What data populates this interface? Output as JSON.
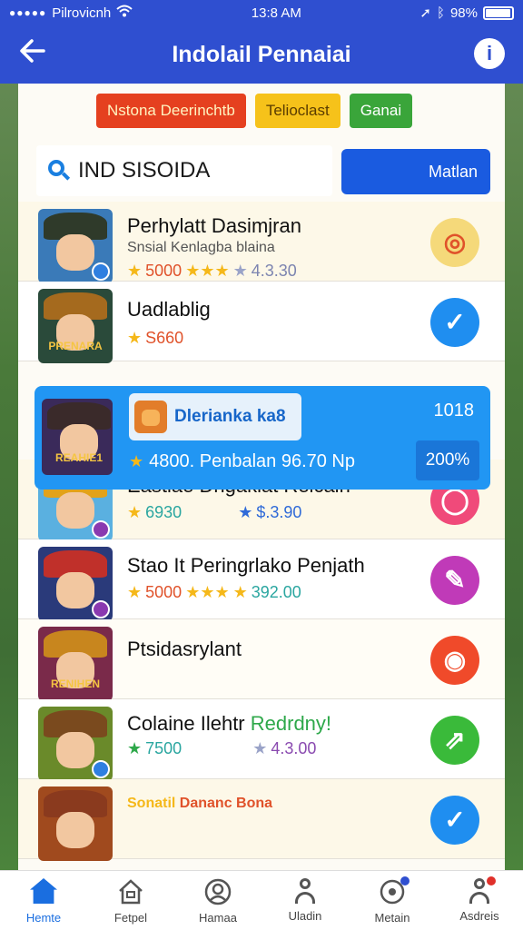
{
  "status_bar": {
    "carrier": "Pilrovicnh",
    "time": "13:8 AM",
    "battery": "98%",
    "battery_level": 0.98
  },
  "header": {
    "title": "Indolail Pennaiai"
  },
  "chips": [
    "Nstona Deerinchtb",
    "Telioclast",
    "Ganai"
  ],
  "search": {
    "value": "IND SISOIDA",
    "button_label": "Matlan"
  },
  "rows": [
    {
      "title": "Perhylatt Dasimjran",
      "subtitle": "Snsial Kenlagba blaina",
      "meta_left": "5000",
      "meta_right": "4.3.30",
      "hat": "#2f3a2a",
      "badge": "#2f7fe0",
      "action_icon": "target-icon",
      "action_color": "#f5d97a"
    },
    {
      "title": "Uadlablig",
      "subtitle": "",
      "meta_left": "S660",
      "meta_right": "",
      "hat": "#a56a1e",
      "badge": "#2f7fe0",
      "avatar_label": "PRENARA",
      "action_icon": "check-icon",
      "action_color": "#1f8ef0"
    },
    {
      "title": "Eastiae Dngakiat Relcain",
      "subtitle": "",
      "meta_left": "6930",
      "meta_right": "$.3.90",
      "hat": "#e2a21a",
      "badge": "#8a3ab0",
      "action_icon": "chat-icon",
      "action_color": "#f04a7a"
    },
    {
      "title": "Staо It Peringrlako Penjath",
      "subtitle": "",
      "meta_left": "5000",
      "meta_right": "392.00",
      "hat": "#c0302a",
      "badge": "#8a3ab0",
      "action_icon": "edit-icon",
      "action_color": "#c03ab8"
    },
    {
      "title": "Ptsidasrylant",
      "subtitle": "",
      "meta_left": "",
      "meta_right": "",
      "hat": "#c8861e",
      "badge": "",
      "avatar_label": "RENIHEN",
      "action_icon": "camera-icon",
      "action_color": "#f04a2a"
    },
    {
      "title": "Colaine Ilehtr",
      "title_accent": "Redrdny!",
      "subtitle": "",
      "meta_left": "7500",
      "meta_right": "4.3.00",
      "hat": "#7a4a1e",
      "badge": "#2f7fe0",
      "action_icon": "share-icon",
      "action_color": "#3aba3a"
    },
    {
      "title": "Sonatil",
      "title_accent": "Dananc Bona",
      "subtitle": "",
      "meta_left": "",
      "meta_right": "",
      "hat": "#8a3a1e",
      "badge": "",
      "action_icon": "check-icon",
      "action_color": "#1f8ef0"
    }
  ],
  "highlight": {
    "tag": "Dlerianka ka8",
    "count": "1018",
    "meta": "4800. Penbalan 96.70 Np",
    "percent": "200%",
    "avatar_label": "REAHIE1"
  },
  "nav": [
    {
      "label": "Hemte",
      "icon": "home-icon",
      "active": true
    },
    {
      "label": "Fetpel",
      "icon": "house-icon",
      "active": false
    },
    {
      "label": "Hamaa",
      "icon": "profile-circle-icon",
      "active": false
    },
    {
      "label": "Uladin",
      "icon": "person-icon",
      "active": false
    },
    {
      "label": "Metain",
      "icon": "notification-icon",
      "active": false,
      "badge_color": "#2f4fd0"
    },
    {
      "label": "Asdreis",
      "icon": "user-alert-icon",
      "active": false,
      "badge_color": "#e0302a"
    }
  ],
  "colors": {
    "brand": "#2f4fd0",
    "accent": "#2196f3"
  }
}
